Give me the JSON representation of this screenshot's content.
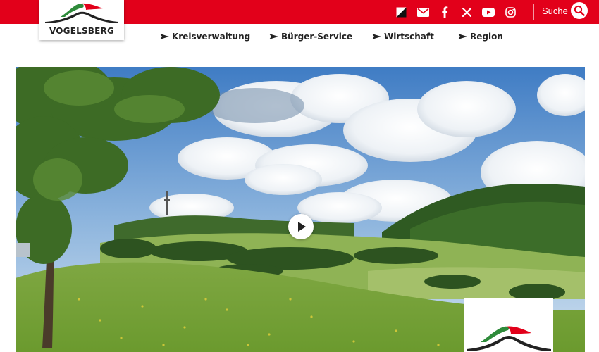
{
  "header": {
    "logo_text": "VOGELSBERG",
    "search_label": "Suche",
    "icons": [
      "contrast-icon",
      "mail-icon",
      "facebook-icon",
      "x-icon",
      "youtube-icon",
      "instagram-icon",
      "search-icon"
    ]
  },
  "nav": {
    "items": [
      {
        "label": "Kreisverwaltung"
      },
      {
        "label": "Bürger-Service"
      },
      {
        "label": "Wirtschaft"
      },
      {
        "label": "Region"
      }
    ]
  },
  "hero": {
    "controls": [
      "play-icon"
    ]
  },
  "colors": {
    "brand_red": "#e2001a",
    "logo_green": "#2e8b3a",
    "text": "#222222"
  }
}
